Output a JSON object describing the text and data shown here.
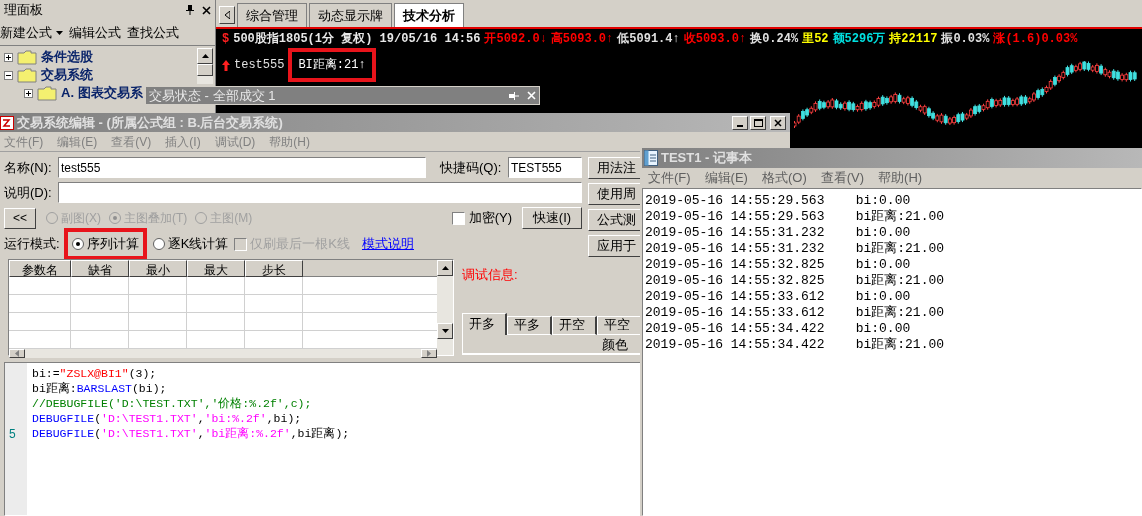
{
  "management_panel": {
    "title": "理面板",
    "toolbar": [
      {
        "label": "新建公式",
        "dropdown": true
      },
      {
        "label": "编辑公式",
        "dropdown": false
      },
      {
        "label": "查找公式",
        "dropdown": false
      }
    ],
    "tree": [
      {
        "label": "条件选股",
        "expanded": false
      },
      {
        "label": "交易系统",
        "expanded": true,
        "children": [
          {
            "label": "A. 图表交易系",
            "expanded": false
          }
        ]
      }
    ]
  },
  "chart_tabs": [
    {
      "label": "综合管理",
      "selected": false
    },
    {
      "label": "动态显示牌",
      "selected": false
    },
    {
      "label": "技术分析",
      "selected": true
    }
  ],
  "chart_header": {
    "symbol_mark": "$",
    "tokens": [
      {
        "text": "500股指1805(1分 复权) 19/05/16 14:56"
      },
      {
        "text": "开5092.0↓",
        "color": "#ff0000"
      },
      {
        "text": "高5093.0↑",
        "color": "#ff0000"
      },
      {
        "text": "低5091.4↑",
        "color": "#e0e0e0"
      },
      {
        "text": "收5093.0↑",
        "color": "#ff0000"
      },
      {
        "text": "换0.24%",
        "color": "#e0e0e0"
      },
      {
        "text": "里52",
        "color": "#ffff00"
      },
      {
        "text": "额5296万",
        "color": "#00e0e0"
      },
      {
        "text": "持22117",
        "color": "#ffff00"
      },
      {
        "text": "振0.03%",
        "color": "#e0e0e0"
      },
      {
        "text": "涨(1.6)0.03%",
        "color": "#ff0000"
      }
    ]
  },
  "indicator_line": {
    "name": "test555",
    "value": "BI距离:21↑"
  },
  "status_window": {
    "title": "交易状态 - 全部成交 1"
  },
  "editor": {
    "title": "交易系统编辑 - (所属公式组 : B.后台交易系统)",
    "menu": [
      "文件(F)",
      "编辑(E)",
      "查看(V)",
      "插入(I)",
      "调试(D)",
      "帮助(H)"
    ],
    "name_label": "名称(N):",
    "name_value": "test555",
    "shortcut_label": "快捷码(Q):",
    "shortcut_value": "TEST555",
    "desc_label": "说明(D):",
    "collapse_button": "<<",
    "chart_type_options": [
      {
        "label": "副图(X)",
        "selected": false,
        "disabled": true
      },
      {
        "label": "主图叠加(T)",
        "selected": true,
        "disabled": true
      },
      {
        "label": "主图(M)",
        "selected": false,
        "disabled": true
      }
    ],
    "encrypt": {
      "label": "加密(Y)",
      "checked": false
    },
    "quick_button": "快速(I)",
    "side_buttons": [
      "用法注",
      "使用周",
      "公式测",
      "应用于"
    ],
    "run_mode_label": "运行模式:",
    "run_modes": [
      {
        "label": "序列计算",
        "selected": true
      },
      {
        "label": "逐K线计算",
        "selected": false
      }
    ],
    "refresh_last": {
      "label": "仅刷最后一根K线",
      "checked": false,
      "disabled": true
    },
    "mode_help_link": "模式说明",
    "param_columns": [
      "参数名",
      "缺省",
      "最小",
      "最大",
      "步长"
    ],
    "debug_label": "调试信息:",
    "signal_tabs": [
      {
        "label": "开多",
        "selected": true
      },
      {
        "label": "平多",
        "selected": false
      },
      {
        "label": "开空",
        "selected": false
      },
      {
        "label": "平空",
        "selected": false
      }
    ],
    "color_label": "颜色",
    "code_lines": [
      {
        "tokens": [
          {
            "kind": "plain",
            "text": "bi:="
          },
          {
            "kind": "literal",
            "text": "\"ZSLX@BI1\""
          },
          {
            "kind": "plain",
            "text": "(3);"
          }
        ]
      },
      {
        "tokens": [
          {
            "kind": "plain",
            "text": "bi距离:"
          },
          {
            "kind": "function",
            "text": "BARSLAST"
          },
          {
            "kind": "plain",
            "text": "(bi);"
          }
        ]
      },
      {
        "tokens": [
          {
            "kind": "comment",
            "text": "//DEBUGFILE('D:\\TEST.TXT','价格:%.2f',c);"
          }
        ]
      },
      {
        "tokens": [
          {
            "kind": "function",
            "text": "DEBUGFILE"
          },
          {
            "kind": "plain",
            "text": "("
          },
          {
            "kind": "string",
            "text": "'D:\\TEST1.TXT'"
          },
          {
            "kind": "plain",
            "text": ","
          },
          {
            "kind": "string",
            "text": "'bi:%.2f'"
          },
          {
            "kind": "plain",
            "text": ",bi);"
          }
        ]
      },
      {
        "line_number": "5",
        "tokens": [
          {
            "kind": "function",
            "text": "DEBUGFILE"
          },
          {
            "kind": "plain",
            "text": "("
          },
          {
            "kind": "string",
            "text": "'D:\\TEST1.TXT'"
          },
          {
            "kind": "plain",
            "text": ","
          },
          {
            "kind": "string",
            "text": "'bi距离:%.2f'"
          },
          {
            "kind": "plain",
            "text": ",bi距离);"
          }
        ]
      }
    ]
  },
  "notepad": {
    "title": "TEST1 - 记事本",
    "menu": [
      "文件(F)",
      "编辑(E)",
      "格式(O)",
      "查看(V)",
      "帮助(H)"
    ],
    "lines": [
      "2019-05-16 14:55:29.563    bi:0.00",
      "2019-05-16 14:55:29.563    bi距离:21.00",
      "2019-05-16 14:55:31.232    bi:0.00",
      "2019-05-16 14:55:31.232    bi距离:21.00",
      "2019-05-16 14:55:32.825    bi:0.00",
      "2019-05-16 14:55:32.825    bi距离:21.00",
      "2019-05-16 14:55:33.612    bi:0.00",
      "2019-05-16 14:55:33.612    bi距离:21.00",
      "2019-05-16 14:55:34.422    bi:0.00",
      "2019-05-16 14:55:34.422    bi距离:21.00"
    ]
  }
}
